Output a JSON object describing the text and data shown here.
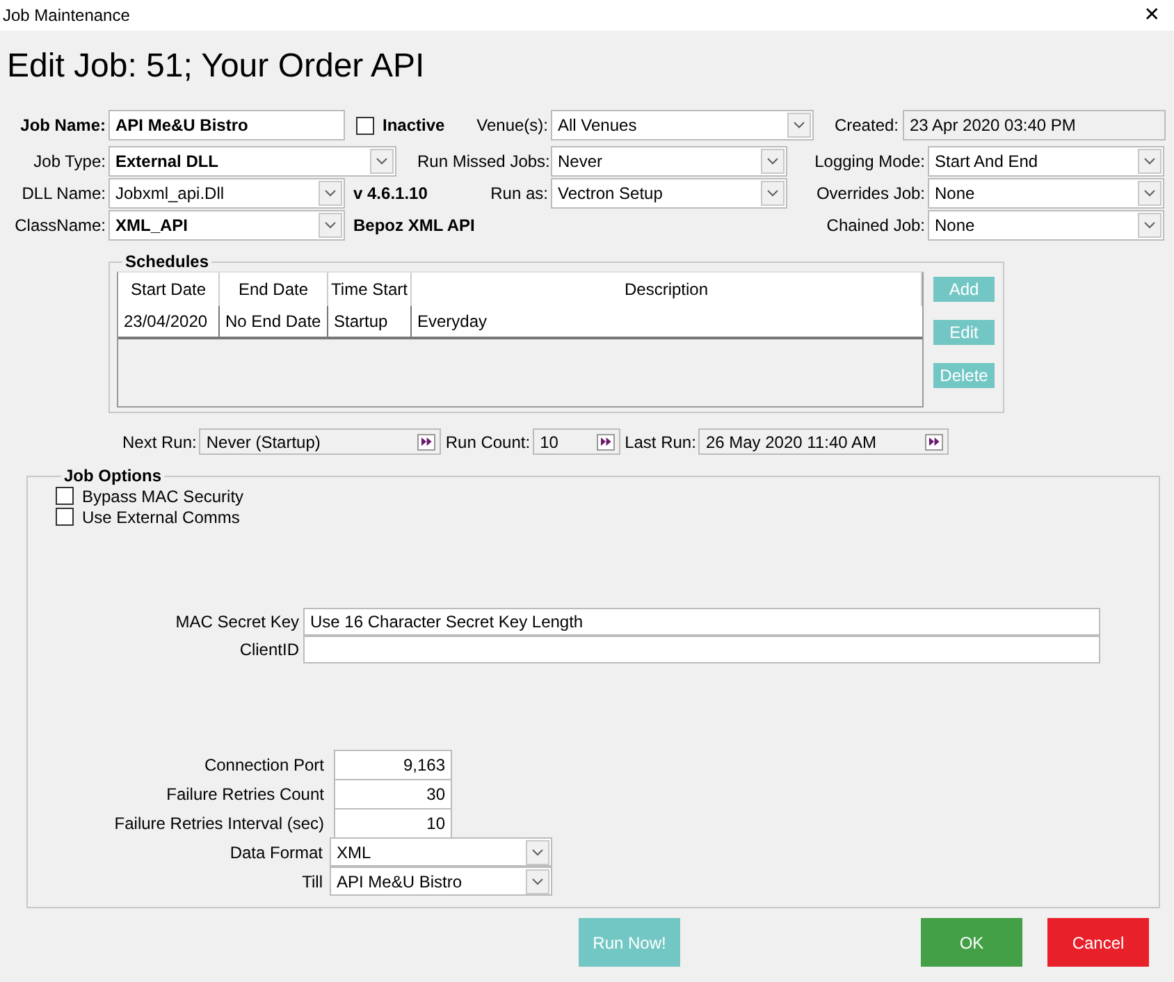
{
  "window": {
    "title": "Job Maintenance",
    "close": "✕"
  },
  "heading": "Edit Job: 51; Your Order API",
  "form_columns": [
    [
      [
        {
          "kind": "label",
          "text": "Job Name:",
          "bold": true
        },
        {
          "kind": "text",
          "value": "API Me&U Bistro",
          "bold": true
        },
        {
          "kind": "checkbox",
          "label": "Inactive",
          "checked": false,
          "bold": true
        }
      ],
      [
        {
          "kind": "label",
          "text": "Job Type:",
          "bold": false
        },
        {
          "kind": "select",
          "value": "External DLL",
          "bold": true
        }
      ],
      [
        {
          "kind": "label",
          "text": "DLL Name:",
          "bold": false
        },
        {
          "kind": "select",
          "value": "Jobxml_api.Dll",
          "bold": false
        },
        {
          "kind": "note",
          "text": "v 4.6.1.10",
          "bold": true
        }
      ],
      [
        {
          "kind": "label",
          "text": "ClassName:",
          "bold": false
        },
        {
          "kind": "select",
          "value": "XML_API",
          "bold": true
        },
        {
          "kind": "note",
          "text": "Bepoz XML API",
          "bold": true
        }
      ]
    ],
    [
      [
        {
          "kind": "label",
          "text": "Venue(s):",
          "bold": false
        },
        {
          "kind": "select",
          "value": "All Venues",
          "bold": false
        }
      ],
      [
        {
          "kind": "label",
          "text": "Run Missed Jobs:",
          "bold": false
        },
        {
          "kind": "select",
          "value": "Never",
          "bold": false
        }
      ],
      [
        {
          "kind": "label",
          "text": "Run as:",
          "bold": false
        },
        {
          "kind": "select",
          "value": "Vectron Setup",
          "bold": false
        }
      ]
    ],
    [
      [
        {
          "kind": "label",
          "text": "Created:",
          "bold": false
        },
        {
          "kind": "readonly",
          "value": "23 Apr 2020 03:40 PM",
          "bold": false
        }
      ],
      [
        {
          "kind": "label",
          "text": "Logging Mode:",
          "bold": false
        },
        {
          "kind": "select",
          "value": "Start And End",
          "bold": false
        }
      ],
      [
        {
          "kind": "label",
          "text": "Overrides Job:",
          "bold": false
        },
        {
          "kind": "select",
          "value": "None",
          "bold": false
        }
      ],
      [
        {
          "kind": "label",
          "text": "Chained Job:",
          "bold": false
        },
        {
          "kind": "select",
          "value": "None",
          "bold": false
        }
      ]
    ]
  ],
  "schedules": {
    "title": "Schedules",
    "columns": [
      "Start Date",
      "End Date",
      "Time Start",
      "Description"
    ],
    "rows": [
      [
        "23/04/2020",
        "No End Date",
        "Startup",
        "Everyday"
      ]
    ],
    "buttons": [
      "Add",
      "Edit",
      "Delete"
    ]
  },
  "run_info": [
    {
      "label": "Next Run:",
      "value": "Never (Startup)"
    },
    {
      "label": "Run Count:",
      "value": "10"
    },
    {
      "label": "Last Run:",
      "value": "26 May 2020 11:40 AM"
    }
  ],
  "job_options": {
    "title": "Job Options",
    "checkboxes": [
      {
        "label": "Bypass MAC Security",
        "checked": false
      },
      {
        "label": "Use External Comms",
        "checked": false
      }
    ],
    "key_fields": [
      {
        "label": "MAC Secret Key",
        "value": "Use 16 Character Secret Key Length"
      },
      {
        "label": "ClientID"
      }
    ],
    "number_fields": [
      {
        "label": "Connection Port",
        "value": "9,163"
      },
      {
        "label": "Failure Retries Count",
        "value": "30"
      },
      {
        "label": "Failure Retries Interval (sec)",
        "value": "10"
      }
    ],
    "selects": [
      {
        "label": "Data Format",
        "value": "XML"
      },
      {
        "label": "Till",
        "value": "API Me&U Bistro"
      }
    ]
  },
  "footer_buttons": [
    {
      "label": "Run Now!",
      "kind": "run"
    },
    {
      "label": "OK",
      "kind": "ok"
    },
    {
      "label": "Cancel",
      "kind": "cancel"
    }
  ]
}
